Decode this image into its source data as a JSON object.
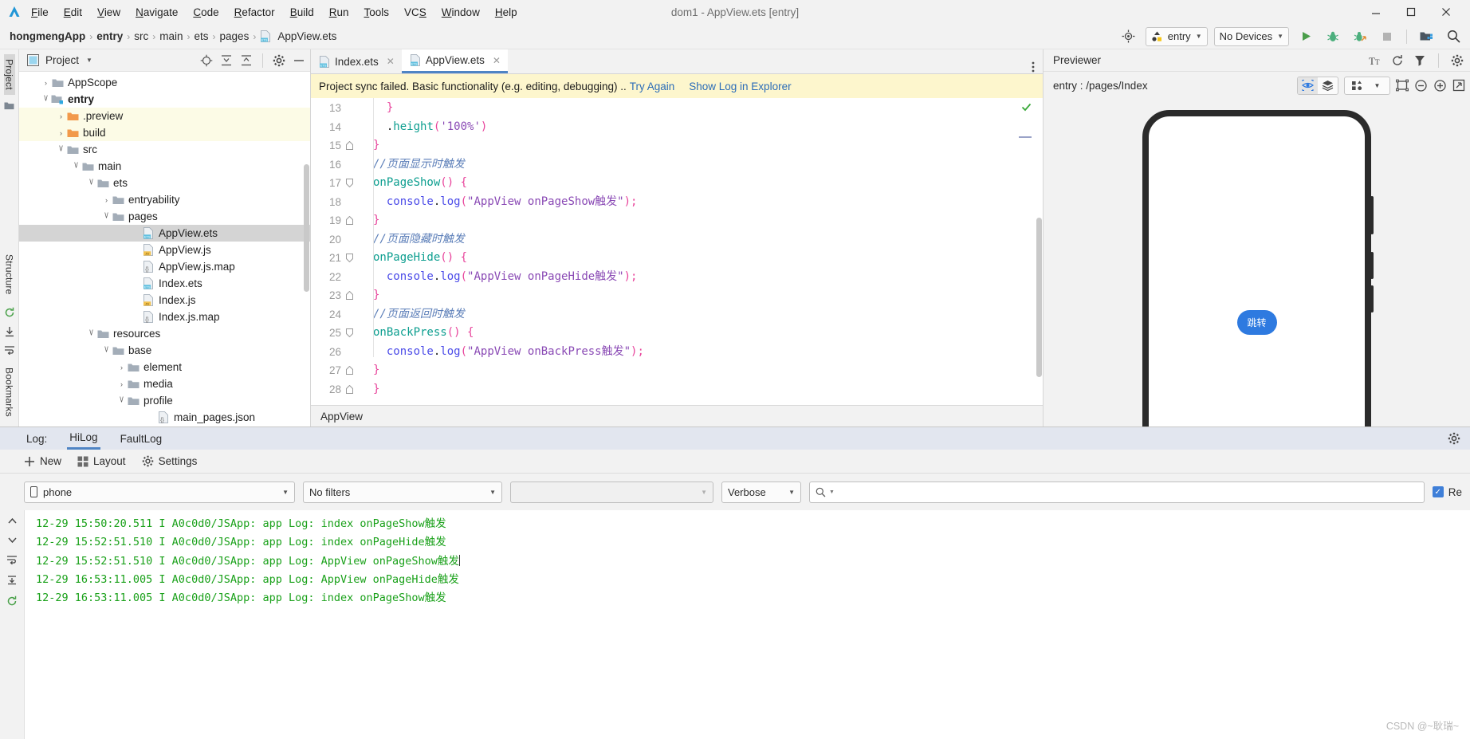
{
  "window": {
    "title": "dom1 - AppView.ets [entry]",
    "controls": [
      "minimize",
      "maximize",
      "close"
    ]
  },
  "menubar": {
    "logo_icon": "deveco-logo-icon",
    "items": [
      "File",
      "Edit",
      "View",
      "Navigate",
      "Code",
      "Refactor",
      "Build",
      "Run",
      "Tools",
      "VCS",
      "Window",
      "Help"
    ]
  },
  "breadcrumb": {
    "items": [
      {
        "label": "hongmengApp",
        "bold": true,
        "icon": null
      },
      {
        "label": "entry",
        "bold": true,
        "icon": null
      },
      {
        "label": "src",
        "bold": false,
        "icon": null
      },
      {
        "label": "main",
        "bold": false,
        "icon": null
      },
      {
        "label": "ets",
        "bold": false,
        "icon": null
      },
      {
        "label": "pages",
        "bold": false,
        "icon": null
      },
      {
        "label": "AppView.ets",
        "bold": false,
        "icon": "ets-file-icon"
      }
    ],
    "separator": "›"
  },
  "nav_right": {
    "target_icon": "select-target-icon",
    "run_config": "entry",
    "run_config_icon": "module-icon",
    "device": "No Devices",
    "buttons": [
      "run-button",
      "debug-button",
      "attach-debugger-button",
      "stop-button",
      "device-manager-button",
      "search-button"
    ]
  },
  "left_strip": {
    "project_label": "Project",
    "structure_label": "Structure",
    "bookmarks_label": "Bookmarks"
  },
  "project_panel": {
    "title": "Project",
    "title_icon": "project-view-icon",
    "actions": [
      "locate-icon",
      "expand-all-icon",
      "collapse-all-icon",
      "settings-gear-icon",
      "hide-icon"
    ],
    "tree": [
      {
        "label": "AppScope",
        "indent": 1,
        "arrow": "right",
        "icon": "folder",
        "state": "normal",
        "bold": false
      },
      {
        "label": "entry",
        "indent": 1,
        "arrow": "down",
        "icon": "folder-module",
        "state": "normal",
        "bold": true
      },
      {
        "label": ".preview",
        "indent": 2,
        "arrow": "right",
        "icon": "folder-orange",
        "state": "highlight",
        "bold": false
      },
      {
        "label": "build",
        "indent": 2,
        "arrow": "right",
        "icon": "folder-orange",
        "state": "highlight",
        "bold": false
      },
      {
        "label": "src",
        "indent": 2,
        "arrow": "down",
        "icon": "folder",
        "state": "normal",
        "bold": false
      },
      {
        "label": "main",
        "indent": 3,
        "arrow": "down",
        "icon": "folder",
        "state": "normal",
        "bold": false
      },
      {
        "label": "ets",
        "indent": 4,
        "arrow": "down",
        "icon": "folder",
        "state": "normal",
        "bold": false
      },
      {
        "label": "entryability",
        "indent": 5,
        "arrow": "right",
        "icon": "folder",
        "state": "normal",
        "bold": false
      },
      {
        "label": "pages",
        "indent": 5,
        "arrow": "down",
        "icon": "folder",
        "state": "normal",
        "bold": false
      },
      {
        "label": "AppView.ets",
        "indent": 7,
        "arrow": "none",
        "icon": "ets",
        "state": "selected",
        "bold": false
      },
      {
        "label": "AppView.js",
        "indent": 7,
        "arrow": "none",
        "icon": "js",
        "state": "normal",
        "bold": false
      },
      {
        "label": "AppView.js.map",
        "indent": 7,
        "arrow": "none",
        "icon": "json",
        "state": "normal",
        "bold": false
      },
      {
        "label": "Index.ets",
        "indent": 7,
        "arrow": "none",
        "icon": "ets",
        "state": "normal",
        "bold": false
      },
      {
        "label": "Index.js",
        "indent": 7,
        "arrow": "none",
        "icon": "js",
        "state": "normal",
        "bold": false
      },
      {
        "label": "Index.js.map",
        "indent": 7,
        "arrow": "none",
        "icon": "json",
        "state": "normal",
        "bold": false
      },
      {
        "label": "resources",
        "indent": 4,
        "arrow": "down",
        "icon": "folder",
        "state": "normal",
        "bold": false
      },
      {
        "label": "base",
        "indent": 5,
        "arrow": "down",
        "icon": "folder",
        "state": "normal",
        "bold": false
      },
      {
        "label": "element",
        "indent": 6,
        "arrow": "right",
        "icon": "folder",
        "state": "normal",
        "bold": false
      },
      {
        "label": "media",
        "indent": 6,
        "arrow": "right",
        "icon": "folder",
        "state": "normal",
        "bold": false
      },
      {
        "label": "profile",
        "indent": 6,
        "arrow": "down",
        "icon": "folder",
        "state": "normal",
        "bold": false
      },
      {
        "label": "main_pages.json",
        "indent": 8,
        "arrow": "none",
        "icon": "json",
        "state": "normal",
        "bold": false
      }
    ]
  },
  "editor": {
    "tabs": [
      {
        "label": "Index.ets",
        "icon": "ets-file-icon",
        "active": false
      },
      {
        "label": "AppView.ets",
        "icon": "ets-file-icon",
        "active": true
      }
    ],
    "tab_overflow_icon": "more-vertical-icon",
    "banner": {
      "message": "Project sync failed. Basic functionality (e.g. editing, debugging) ..",
      "link1": "Try Again",
      "link2": "Show Log in Explorer"
    },
    "status_label": "AppView",
    "lines": [
      {
        "num": "13",
        "fold": "none",
        "tokens": [
          {
            "t": "  ",
            "c": "pl"
          },
          {
            "t": "}",
            "c": "pun"
          }
        ]
      },
      {
        "num": "14",
        "fold": "none",
        "tokens": [
          {
            "t": "  .",
            "c": "pl"
          },
          {
            "t": "height",
            "c": "kw"
          },
          {
            "t": "(",
            "c": "pun"
          },
          {
            "t": "'100%'",
            "c": "str"
          },
          {
            "t": ")",
            "c": "pun"
          }
        ]
      },
      {
        "num": "15",
        "fold": "end",
        "tokens": [
          {
            "t": "}",
            "c": "pun"
          }
        ]
      },
      {
        "num": "16",
        "fold": "none",
        "tokens": [
          {
            "t": "//页面显示时触发",
            "c": "cmt"
          }
        ]
      },
      {
        "num": "17",
        "fold": "start",
        "tokens": [
          {
            "t": "onPageShow",
            "c": "kw"
          },
          {
            "t": "() ",
            "c": "pun"
          },
          {
            "t": "{",
            "c": "pun"
          }
        ]
      },
      {
        "num": "18",
        "fold": "none",
        "tokens": [
          {
            "t": "  console",
            "c": "fn"
          },
          {
            "t": ".",
            "c": "pl"
          },
          {
            "t": "log",
            "c": "fn"
          },
          {
            "t": "(",
            "c": "pun"
          },
          {
            "t": "\"AppView onPageShow触发\"",
            "c": "str"
          },
          {
            "t": ")",
            "c": "pun"
          },
          {
            "t": ";",
            "c": "pun"
          }
        ]
      },
      {
        "num": "19",
        "fold": "end",
        "tokens": [
          {
            "t": "}",
            "c": "pun"
          }
        ]
      },
      {
        "num": "20",
        "fold": "none",
        "tokens": [
          {
            "t": "//页面隐藏时触发",
            "c": "cmt"
          }
        ]
      },
      {
        "num": "21",
        "fold": "start",
        "tokens": [
          {
            "t": "onPageHide",
            "c": "kw"
          },
          {
            "t": "() ",
            "c": "pun"
          },
          {
            "t": "{",
            "c": "pun"
          }
        ]
      },
      {
        "num": "22",
        "fold": "none",
        "tokens": [
          {
            "t": "  console",
            "c": "fn"
          },
          {
            "t": ".",
            "c": "pl"
          },
          {
            "t": "log",
            "c": "fn"
          },
          {
            "t": "(",
            "c": "pun"
          },
          {
            "t": "\"AppView onPageHide触发\"",
            "c": "str"
          },
          {
            "t": ")",
            "c": "pun"
          },
          {
            "t": ";",
            "c": "pun"
          }
        ]
      },
      {
        "num": "23",
        "fold": "end",
        "tokens": [
          {
            "t": "}",
            "c": "pun"
          }
        ]
      },
      {
        "num": "24",
        "fold": "none",
        "tokens": [
          {
            "t": "//页面返回时触发",
            "c": "cmt"
          }
        ]
      },
      {
        "num": "25",
        "fold": "start",
        "tokens": [
          {
            "t": "onBackPress",
            "c": "kw"
          },
          {
            "t": "() ",
            "c": "pun"
          },
          {
            "t": "{",
            "c": "pun"
          }
        ]
      },
      {
        "num": "26",
        "fold": "none",
        "tokens": [
          {
            "t": "  console",
            "c": "fn"
          },
          {
            "t": ".",
            "c": "pl"
          },
          {
            "t": "log",
            "c": "fn"
          },
          {
            "t": "(",
            "c": "pun"
          },
          {
            "t": "\"AppView onBackPress触发\"",
            "c": "str"
          },
          {
            "t": ")",
            "c": "pun"
          },
          {
            "t": ";",
            "c": "pun"
          }
        ]
      },
      {
        "num": "27",
        "fold": "end",
        "tokens": [
          {
            "t": "}",
            "c": "pun"
          }
        ]
      },
      {
        "num": "28",
        "fold": "end",
        "tokens": [
          {
            "t": "}",
            "c": "pun"
          }
        ]
      }
    ]
  },
  "previewer": {
    "title": "Previewer",
    "route": "entry : /pages/Index",
    "head_icons": [
      "font-size-icon",
      "refresh-icon",
      "inspector-icon",
      "settings-gear-icon"
    ],
    "toolbar_icons": [
      "live-preview-icon",
      "layers-icon",
      "multi-device-icon",
      "chevron-down-icon",
      "resize-icon",
      "zoom-out-icon",
      "zoom-in-icon",
      "fit-screen-icon"
    ],
    "device_button_label": "跳转"
  },
  "bottom_panel": {
    "log_prefix": "Log:",
    "tabs": [
      {
        "label": "HiLog",
        "active": true
      },
      {
        "label": "FaultLog",
        "active": false
      }
    ],
    "settings_gear_icon": "settings-gear-icon",
    "toolbar": [
      {
        "label": "New",
        "icon": "plus-icon"
      },
      {
        "label": "Layout",
        "icon": "grid-icon"
      },
      {
        "label": "Settings",
        "icon": "gear-icon"
      }
    ],
    "filters": {
      "device": "phone",
      "device_icon": "phone-icon",
      "filter": "No filters",
      "process": "",
      "level": "Verbose",
      "search_placeholder": "",
      "search_icon": "search-icon",
      "regex_checkbox_label": "Re",
      "regex_checked": true
    },
    "log_lines": [
      "12-29 15:50:20.511 I A0c0d0/JSApp: app Log: index onPageShow触发",
      "12-29 15:52:51.510 I A0c0d0/JSApp: app Log: index onPageHide触发",
      "12-29 15:52:51.510 I A0c0d0/JSApp: app Log: AppView onPageShow触发",
      "12-29 16:53:11.005 I A0c0d0/JSApp: app Log: AppView onPageHide触发",
      "12-29 16:53:11.005 I A0c0d0/JSApp: app Log: index onPageShow触发"
    ],
    "log_cursor_line": 2,
    "side_icons": [
      "scroll-up-icon",
      "scroll-down-icon",
      "soft-wrap-icon",
      "scroll-end-icon",
      "restart-icon"
    ]
  },
  "watermark": "CSDN @~耿瑞~",
  "colors": {
    "accent": "#4f84c4",
    "banner_bg": "#fdf6cd",
    "link": "#2b6cb8",
    "log_text": "#1aa11a",
    "blue_button": "#2e7ae0",
    "highlight_row": "#fcfbe6",
    "selected_row": "#d4d4d4"
  }
}
